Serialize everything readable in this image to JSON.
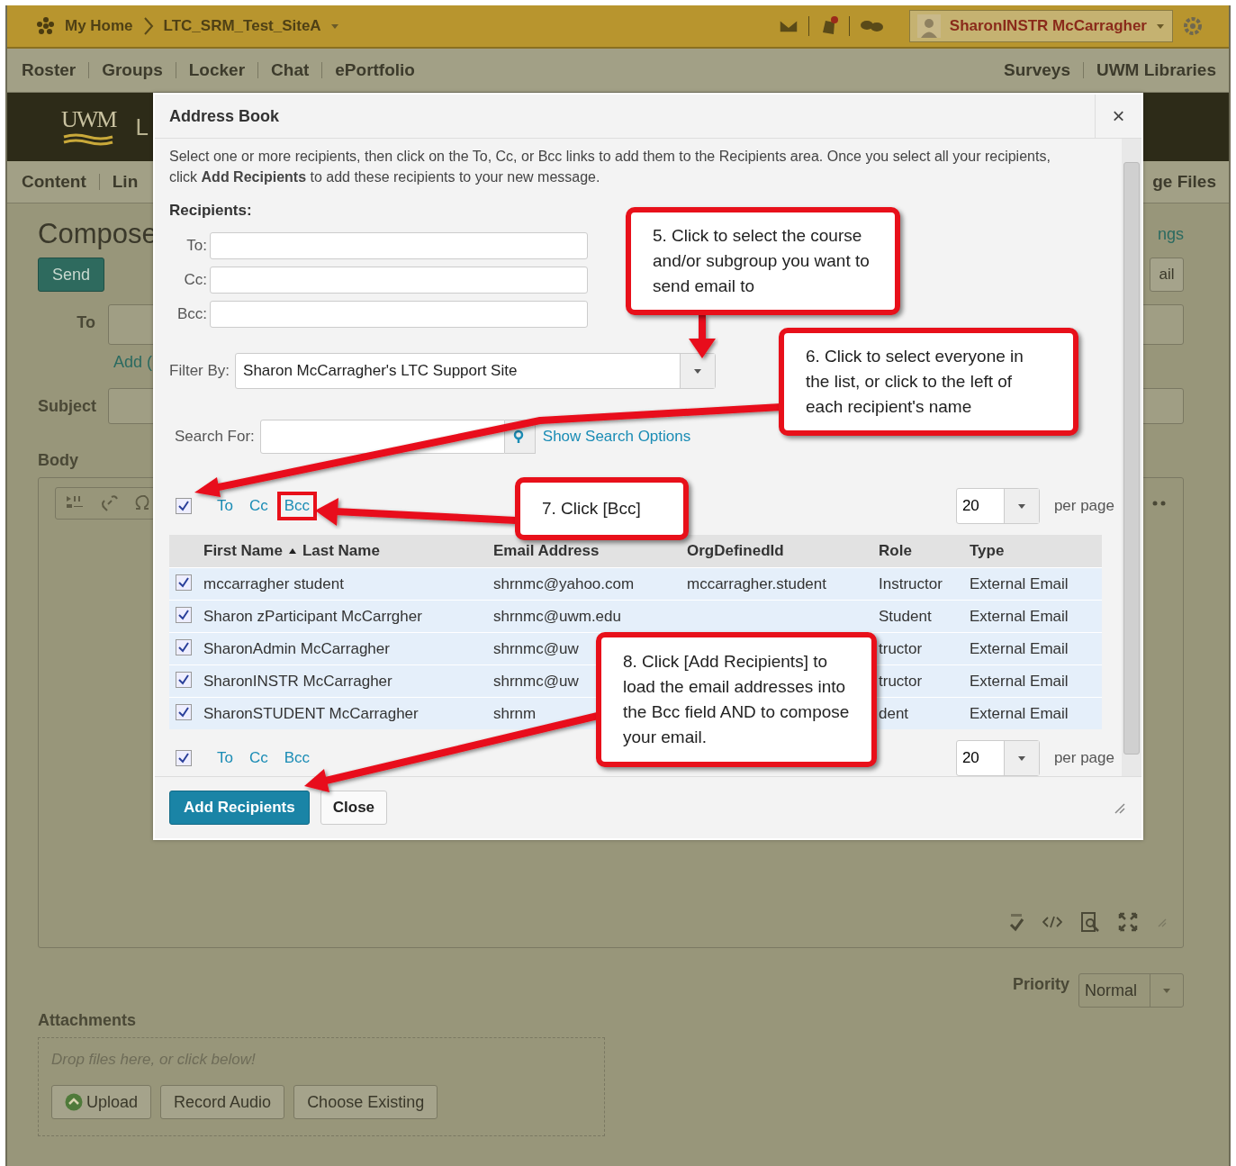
{
  "top_bar": {
    "home": "My Home",
    "course": "LTC_SRM_Test_SiteA",
    "user": "SharonINSTR McCarragher"
  },
  "nav": {
    "left": [
      "Roster",
      "Groups",
      "Locker",
      "Chat",
      "ePortfolio"
    ],
    "right": [
      "Surveys",
      "UWM Libraries"
    ]
  },
  "banner": {
    "logo": "UWM",
    "title_fragment": "L"
  },
  "course_nav": {
    "left": [
      "Content",
      "Lin"
    ],
    "right": [
      "ge Files"
    ]
  },
  "compose": {
    "title": "Compose",
    "send": "Send",
    "side_link": "ngs",
    "side_button": "ail",
    "to_label": "To",
    "add_link": "Add (",
    "subject_label": "Subject",
    "body_label": "Body",
    "priority_label": "Priority",
    "priority": "Normal",
    "attachments_label": "Attachments",
    "drop_hint": "Drop files here, or click below!",
    "buttons": [
      {
        "label": "Upload",
        "kind": "upload"
      },
      {
        "label": "Record Audio",
        "kind": "plain"
      },
      {
        "label": "Choose Existing",
        "kind": "plain"
      }
    ]
  },
  "dialog": {
    "title": "Address Book",
    "close": "×",
    "intro": "Select one or more recipients, then click on the To, Cc, or Bcc links to add them to the Recipients area. Once you select all your recipients, click **Add Recipients** to add these recipients to your new message.",
    "recipients_label": "Recipients:",
    "fields": [
      {
        "label": "To:"
      },
      {
        "label": "Cc:"
      },
      {
        "label": "Bcc:"
      }
    ],
    "filter_label": "Filter By:",
    "filter_value": "Sharon McCarragher's LTC Support Site",
    "search_label": "Search For:",
    "search_link": "Show Search Options",
    "top_bar": {
      "checked": true,
      "links": [
        {
          "label": "To",
          "highlighted": false
        },
        {
          "label": "Cc",
          "highlighted": false
        },
        {
          "label": "Bcc",
          "highlighted": true
        }
      ],
      "per_page": "20",
      "per_page_label": "per page"
    },
    "columns": [
      {
        "label": "First Name",
        "sorted": true
      },
      {
        "label": "Last Name",
        "sorted": false
      },
      {
        "label": "Email Address",
        "sorted": false
      },
      {
        "label": "OrgDefinedId",
        "sorted": false
      },
      {
        "label": "Role",
        "sorted": false
      },
      {
        "label": "Type",
        "sorted": false
      }
    ],
    "rows": [
      {
        "checked": true,
        "name": "mccarragher student",
        "email": "shrnmc@yahoo.com",
        "org_defined_id": "mccarragher.student",
        "role": "Instructor",
        "type": "External Email"
      },
      {
        "checked": true,
        "name": "Sharon zParticipant McCarrgher",
        "email": "shrnmc@uwm.edu",
        "role": "Student",
        "type": "External Email"
      },
      {
        "checked": true,
        "name": "SharonAdmin McCarragher",
        "email": "shrnmc@uw",
        "role": "tructor",
        "type": "External Email"
      },
      {
        "checked": true,
        "name": "SharonINSTR McCarragher",
        "email": "shrnmc@uw",
        "role": "tructor",
        "type": "External Email"
      },
      {
        "checked": true,
        "name": "SharonSTUDENT McCarragher",
        "email": "shrnm",
        "role": "dent",
        "type": "External Email"
      }
    ],
    "bottom_bar": {
      "checked": true,
      "links": [
        {
          "label": "To",
          "highlighted": false
        },
        {
          "label": "Cc",
          "highlighted": false
        },
        {
          "label": "Bcc",
          "highlighted": false
        }
      ],
      "per_page": "20",
      "per_page_label": "per page"
    },
    "buttons": [
      {
        "label": "Add Recipients",
        "kind": "primary"
      },
      {
        "label": "Close",
        "kind": "plain"
      }
    ]
  },
  "callouts": [
    {
      "text": "5. Click to select the course and/or subgroup you want to send email to"
    },
    {
      "text": "6. Click to select everyone in the list, or click to the left of each recipient's name"
    },
    {
      "text": "7. Click [Bcc]"
    },
    {
      "text": "8. Click [Add Recipients] to load the email addresses into the Bcc field AND to compose your email."
    }
  ]
}
